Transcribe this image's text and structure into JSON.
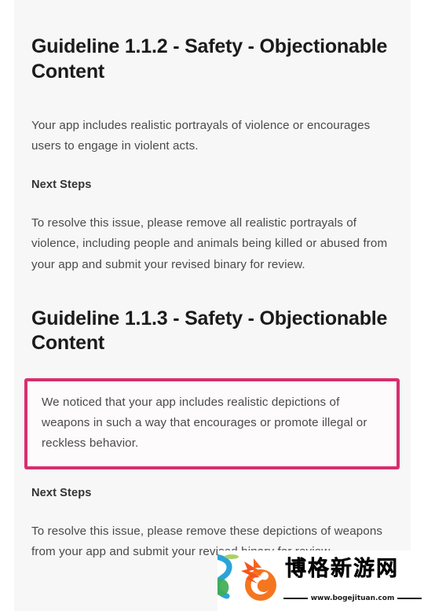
{
  "document": {
    "sections": [
      {
        "heading": "Guideline 1.1.2 - Safety - Objectionable Content",
        "body": "Your app includes realistic portrayals of violence or encourages users to engage in violent acts.",
        "next_steps_label": "Next Steps",
        "next_steps_body": "To resolve this issue, please remove all realistic portrayals of violence, including people and animals being killed or abused from your app and submit your revised binary for review."
      },
      {
        "heading": "Guideline 1.1.3 - Safety - Objectionable Content",
        "body": "We noticed that your app includes realistic depictions of weapons in such a way that encourages or promote illegal or reckless behavior.",
        "next_steps_label": "Next Steps",
        "next_steps_body": "To resolve this issue, please remove these depictions of weapons from your app and submit your revised binary for review."
      }
    ]
  },
  "highlight": {
    "border_color": "#d62f6e",
    "fill_color": "#fdfbfc"
  },
  "watermark": {
    "title": "博格新游网",
    "url": "www.bogejituan.com",
    "logo_color": "#f4761f",
    "accent_color": "#2aa4d8"
  },
  "theme": {
    "page_background": "#ffffff",
    "card_background": "#f7f7f7",
    "heading_color": "#1b1b1b",
    "body_color": "#4a4a4a"
  }
}
